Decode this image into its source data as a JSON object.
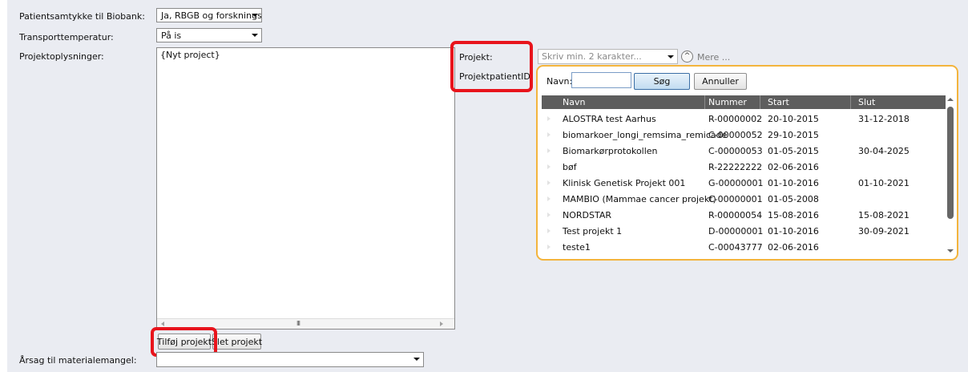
{
  "form": {
    "consent_label": "Patientsamtykke til Biobank:",
    "consent_value": "Ja, RBGB og forskningsp",
    "transport_label": "Transporttemperatur:",
    "transport_value": "På is",
    "projinfo_label": "Projektoplysninger:",
    "projects_list": [
      "{Nyt project}"
    ],
    "add_project": "Tilføj projekt",
    "delete_project": "Slet projekt",
    "reason_label": "Årsag til materialemangel:",
    "reason_value": ""
  },
  "project_panel": {
    "project_label": "Projekt:",
    "patient_id_label": "ProjektpatientID:",
    "search_placeholder": "Skriv min. 2 karakter...",
    "more_link": "Mere ...",
    "popup": {
      "name_label": "Navn:",
      "name_value": "",
      "search_button": "Søg",
      "cancel_button": "Annuller",
      "columns": [
        "Navn",
        "Nummer",
        "Start",
        "Slut"
      ],
      "rows": [
        {
          "name": "ALOSTRA test Aarhus",
          "number": "R-00000002",
          "start": "20-10-2015",
          "end": "31-12-2018"
        },
        {
          "name": "biomarkoer_longi_remsima_remicade",
          "number": "C-00000052",
          "start": "29-10-2015",
          "end": ""
        },
        {
          "name": "Biomarkørprotokollen",
          "number": "C-00000053",
          "start": "01-05-2015",
          "end": "30-04-2025"
        },
        {
          "name": "bøf",
          "number": "R-22222222",
          "start": "02-06-2016",
          "end": ""
        },
        {
          "name": "Klinisk Genetisk Projekt 001",
          "number": "G-00000001",
          "start": "01-10-2016",
          "end": "01-10-2021"
        },
        {
          "name": "MAMBIO (Mammae cancer projekt)",
          "number": "C-00000001",
          "start": "01-05-2008",
          "end": ""
        },
        {
          "name": "NORDSTAR",
          "number": "R-00000054",
          "start": "15-08-2016",
          "end": "15-08-2021"
        },
        {
          "name": "Test projekt 1",
          "number": "D-00000001",
          "start": "01-10-2016",
          "end": "30-09-2021"
        },
        {
          "name": "teste1",
          "number": "C-00043777",
          "start": "02-06-2016",
          "end": ""
        }
      ]
    }
  },
  "colors": {
    "page_bg": "#eaecf2",
    "highlight": "#e8141c",
    "popup_border": "#f3b43d",
    "grid_header": "#5d5d5d"
  },
  "icons": {
    "collapse": "chevron-up-circle-icon",
    "dropdown": "triangle-down-icon"
  }
}
